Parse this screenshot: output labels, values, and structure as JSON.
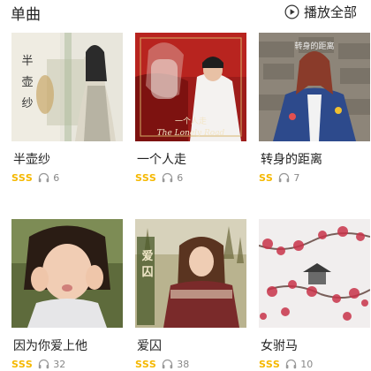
{
  "header": {
    "title": "单曲",
    "play_all_label": "播放全部",
    "play_icon": "play-circle-icon"
  },
  "colors": {
    "quality_badge": "#f5b800",
    "count_text": "#888888"
  },
  "songs": [
    {
      "title": "半壶纱",
      "quality": "SSS",
      "listen_count": "6",
      "cover_text": "半壶纱"
    },
    {
      "title": "一个人走",
      "quality": "SSS",
      "listen_count": "6",
      "cover_text": "一个人走"
    },
    {
      "title": "转身的距离",
      "quality": "SS",
      "listen_count": "7",
      "cover_text": "转身的距离"
    },
    {
      "title": "因为你爱上他",
      "quality": "SSS",
      "listen_count": "32",
      "cover_text": ""
    },
    {
      "title": "爱囚",
      "quality": "SSS",
      "listen_count": "38",
      "cover_text": "爱囚"
    },
    {
      "title": "女驸马",
      "quality": "SSS",
      "listen_count": "10",
      "cover_text": ""
    }
  ]
}
